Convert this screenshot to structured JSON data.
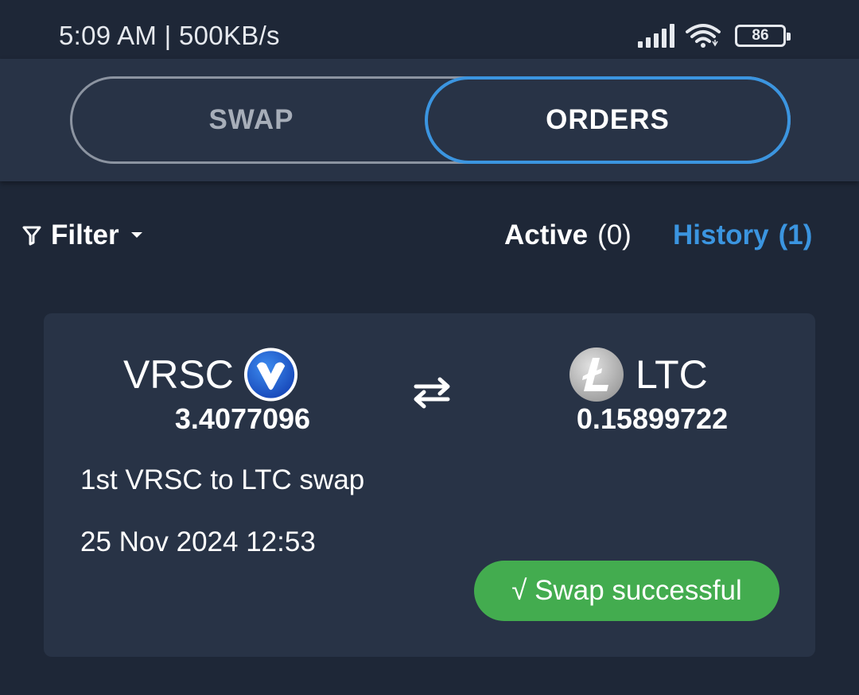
{
  "status_bar": {
    "time": "5:09 AM | 500KB/s",
    "battery": "86",
    "icons": [
      "signal-icon",
      "wifi-icon",
      "battery-icon"
    ]
  },
  "header": {
    "tabs": [
      {
        "label": "SWAP",
        "selected": false
      },
      {
        "label": "ORDERS",
        "selected": true
      }
    ]
  },
  "toolbar": {
    "filter_label": "Filter",
    "active_label": "Active",
    "active_count": "(0)",
    "history_label": "History",
    "history_count": "(1)"
  },
  "order": {
    "from_symbol": "VRSC",
    "from_amount": "3.4077096",
    "to_symbol": "LTC",
    "to_amount": "0.15899722",
    "memo": "1st VRSC to LTC swap",
    "date": "25 Nov 2024 12:53",
    "status": "√ Swap successful"
  },
  "colors": {
    "background": "#1e2737",
    "card": "#283346",
    "accent": "#3b95e0",
    "success": "#43ac4f"
  }
}
